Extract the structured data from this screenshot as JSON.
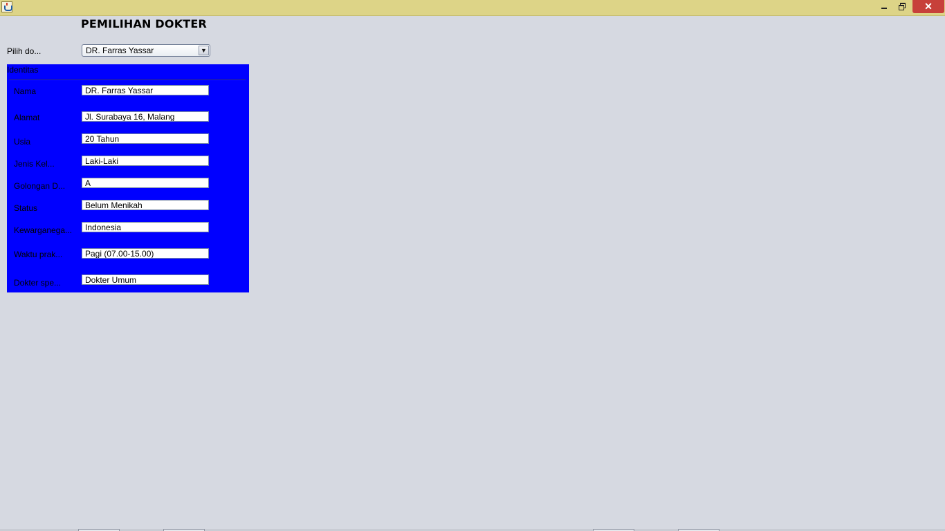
{
  "window": {
    "minimize_icon": "minimize-icon",
    "restore_icon": "restore-icon",
    "close_glyph": "✕",
    "app_icon": "java-cup-icon"
  },
  "header": {
    "title": "PEMILIHAN DOKTER"
  },
  "selector": {
    "label": "Pilih do...",
    "selected": "DR. Farras Yassar",
    "arrow": "▼"
  },
  "panel": {
    "title": "Identitas",
    "color": "#0000ff",
    "fields": [
      {
        "label": "Nama",
        "value": "DR. Farras Yassar"
      },
      {
        "label": "Alamat",
        "value": "Jl. Surabaya 16, Malang"
      },
      {
        "label": "Usia",
        "value": "20 Tahun"
      },
      {
        "label": "Jenis Kel...",
        "value": "Laki-Laki"
      },
      {
        "label": "Golongan D...",
        "value": "A"
      },
      {
        "label": "Status",
        "value": "Belum Menikah"
      },
      {
        "label": "Kewarganega...",
        "value": "Indonesia"
      },
      {
        "label": "Waktu prak...",
        "value": " Pagi (07.00-15.00)"
      },
      {
        "label": "Dokter spe...",
        "value": "Dokter Umum"
      }
    ]
  }
}
